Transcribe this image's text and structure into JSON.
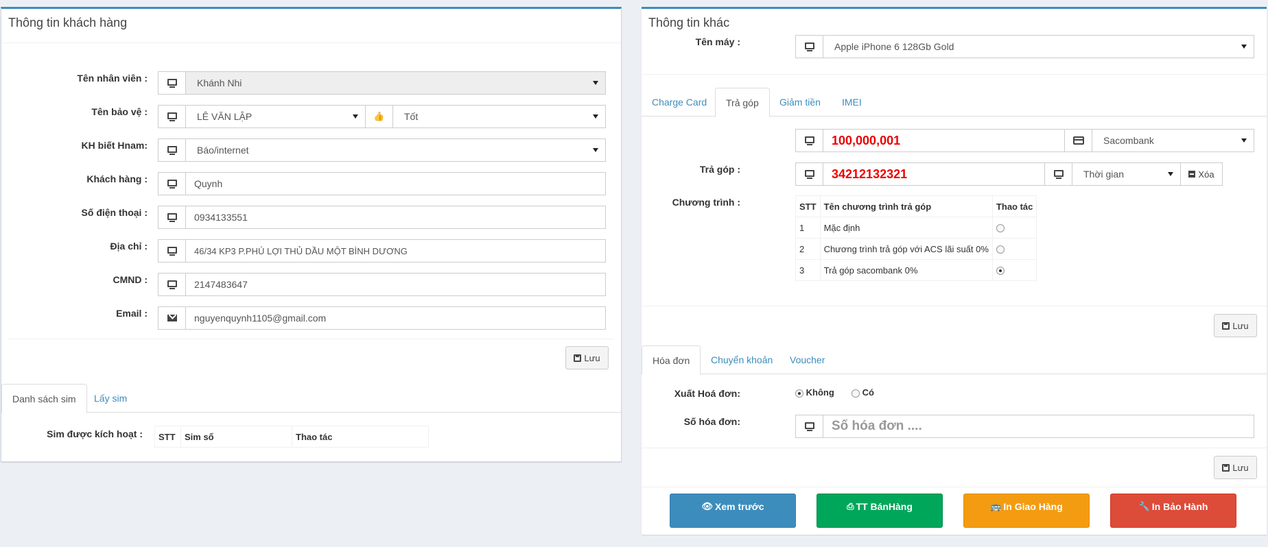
{
  "customer_panel": {
    "title": "Thông tin khách hàng",
    "fields": {
      "employee": {
        "label": "Tên nhân viên :",
        "value": "Khánh Nhi"
      },
      "guard": {
        "label": "Tên bảo vệ :",
        "value": "LÊ VĂN LẬP",
        "rating": "Tốt"
      },
      "source": {
        "label": "KH biết Hnam:",
        "value": "Báo/internet"
      },
      "customer": {
        "label": "Khách hàng :",
        "value": "Quynh"
      },
      "phone": {
        "label": "Số điện thoại :",
        "value": "0934133551"
      },
      "address": {
        "label": "Địa chỉ :",
        "value": "46/34 KP3 P.PHÚ LỢI THỦ DẦU  MỘT BÌNH DƯƠNG"
      },
      "id_card": {
        "label": "CMND :",
        "value": "2147483647"
      },
      "email": {
        "label": "Email :",
        "value": "nguyenquynh1105@gmail.com"
      }
    },
    "save_label": "Lưu",
    "sim_tabs": [
      "Danh sách sim",
      "Lấy sim"
    ],
    "sim_label": "Sim được kích hoạt :",
    "sim_table_headers": [
      "STT",
      "Sim số",
      "Thao tác"
    ]
  },
  "other_panel": {
    "title": "Thông tin khác",
    "device_label": "Tên máy :",
    "device_value": "Apple iPhone 6 128Gb Gold",
    "tabs": [
      "Charge Card",
      "Trả góp",
      "Giảm tiền",
      "IMEI"
    ],
    "amount": "100,000,001",
    "bank": "Sacombank",
    "installment_label": "Trả góp :",
    "installment_value": "34212132321",
    "time_placeholder": "Thời gian",
    "delete_label": "Xóa",
    "program_label": "Chương trình :",
    "program_headers": [
      "STT",
      "Tên chương trình trả góp",
      "Thao tác"
    ],
    "programs": [
      {
        "stt": "1",
        "name": "Mặc định",
        "selected": false
      },
      {
        "stt": "2",
        "name": "Chương trình trả góp với ACS lãi suất 0%",
        "selected": false
      },
      {
        "stt": "3",
        "name": "Trả góp sacombank 0%",
        "selected": true
      }
    ],
    "save_label": "Lưu",
    "invoice_tabs": [
      "Hóa đơn",
      "Chuyển khoản",
      "Voucher"
    ],
    "invoice_export_label": "Xuất Hoá đơn:",
    "invoice_no": "Không",
    "invoice_yes": "Có",
    "invoice_number_label": "Số hóa đơn:",
    "invoice_number_placeholder": "Số hóa đơn ....",
    "save_label_2": "Lưu"
  },
  "actions": {
    "preview": "Xem trước",
    "sales_info": "TT BánHàng",
    "print_delivery": "In Giao Hàng",
    "print_warranty": "In Bảo Hành"
  },
  "colors": {
    "accent": "#3c8dbc",
    "preview": "#3c8dbc",
    "sales": "#00a65a",
    "delivery": "#f39c12",
    "warranty": "#dd4b39",
    "amount_text": "#e00000"
  }
}
